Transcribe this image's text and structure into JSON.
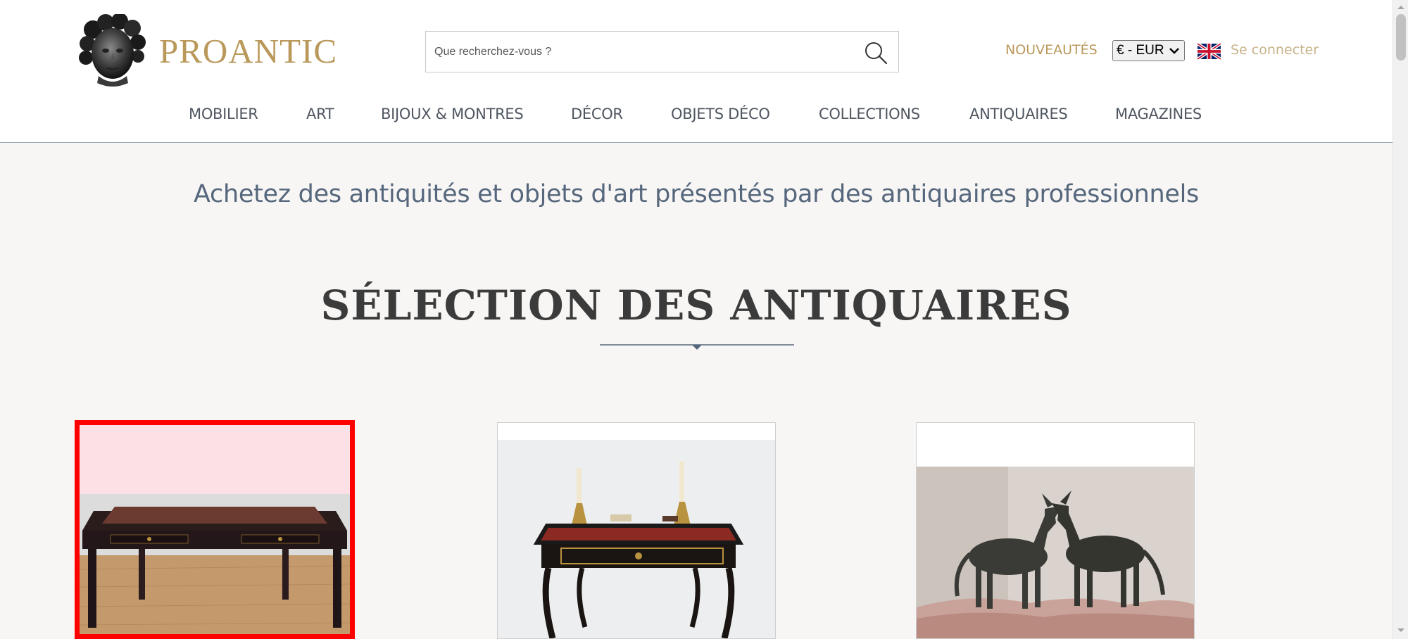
{
  "header": {
    "logo_text": "PROANTIC",
    "search": {
      "placeholder": "Que recherchez-vous ?",
      "icon": "search-icon"
    },
    "nouveautes": "NOUVEAUTÉS",
    "currency": "€ - EUR",
    "language_flag": "uk-flag-icon",
    "login": "Se connecter"
  },
  "nav": {
    "items": [
      {
        "label": "MOBILIER"
      },
      {
        "label": "ART"
      },
      {
        "label": "BIJOUX & MONTRES"
      },
      {
        "label": "DÉCOR"
      },
      {
        "label": "OBJETS DÉCO"
      },
      {
        "label": "COLLECTIONS"
      },
      {
        "label": "ANTIQUAIRES"
      },
      {
        "label": "MAGAZINES"
      }
    ]
  },
  "main": {
    "tagline": "Achetez des antiquités et objets d'art présentés par des antiquaires professionnels",
    "section_title": "SÉLECTION DES ANTIQUAIRES"
  },
  "colors": {
    "brand_gold": "#b9985a",
    "nav_text": "#4f5660",
    "tagline_blue": "#56677d",
    "highlight_red": "#ff0000"
  }
}
